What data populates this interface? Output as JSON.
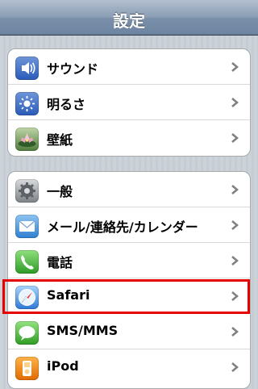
{
  "navbar": {
    "title": "設定"
  },
  "groups": [
    {
      "items": [
        {
          "label": "サウンド",
          "icon": "sound-icon"
        },
        {
          "label": "明るさ",
          "icon": "brightness-icon"
        },
        {
          "label": "壁紙",
          "icon": "wallpaper-icon"
        }
      ]
    },
    {
      "items": [
        {
          "label": "一般",
          "icon": "general-gear-icon"
        },
        {
          "label": "メール/連絡先/カレンダー",
          "icon": "mail-icon"
        },
        {
          "label": "電話",
          "icon": "phone-icon"
        },
        {
          "label": "Safari",
          "icon": "safari-compass-icon",
          "highlighted": true
        },
        {
          "label": "SMS/MMS",
          "icon": "sms-bubble-icon"
        },
        {
          "label": "iPod",
          "icon": "ipod-icon"
        }
      ]
    }
  ],
  "colors": {
    "highlight": "#e60000",
    "background": "#c5ccd4"
  }
}
